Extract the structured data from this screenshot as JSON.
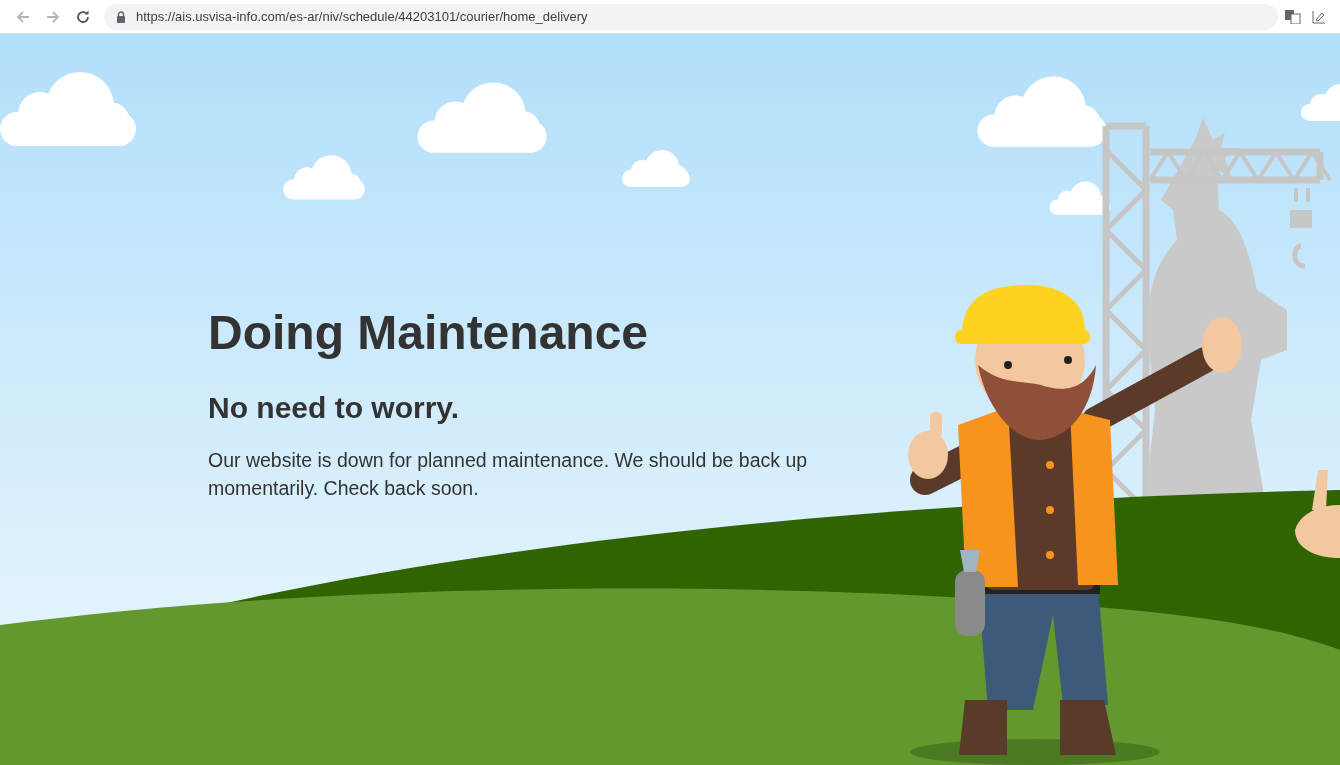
{
  "browser": {
    "url": "https://ais.usvisa-info.com/es-ar/niv/schedule/44203101/courier/home_delivery"
  },
  "page": {
    "title": "Doing Maintenance",
    "subtitle": "No need to worry.",
    "message": "Our website is down for planned maintenance. We should be back up momentarily. Check back soon."
  }
}
